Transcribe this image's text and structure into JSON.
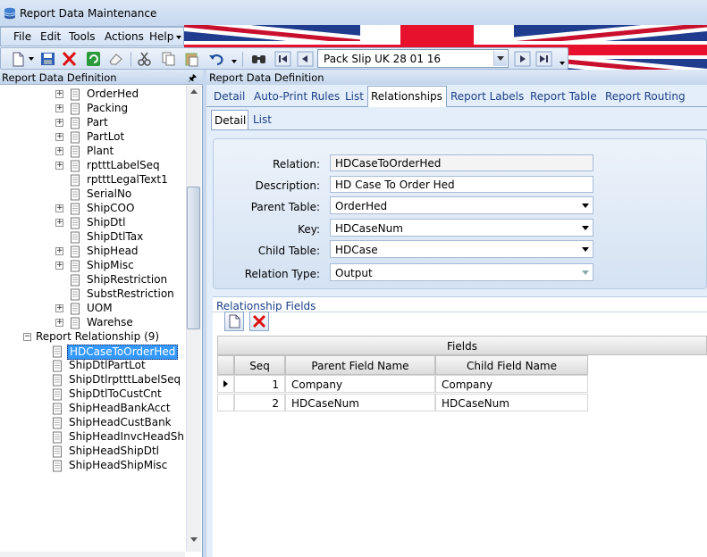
{
  "window": {
    "title": "Report Data Maintenance"
  },
  "menu": [
    "File",
    "Edit",
    "Tools",
    "Actions",
    "Help"
  ],
  "toolbar": {
    "record_selector": "Pack Slip UK 28 01 16"
  },
  "left_panel": {
    "title": "Report Data Definition",
    "tree_items": [
      {
        "label": "OrderHed",
        "expandable": true
      },
      {
        "label": "Packing",
        "expandable": true
      },
      {
        "label": "Part",
        "expandable": true
      },
      {
        "label": "PartLot",
        "expandable": true
      },
      {
        "label": "Plant",
        "expandable": true
      },
      {
        "label": "rptttLabelSeq",
        "expandable": true
      },
      {
        "label": "rptttLegalText1",
        "expandable": false
      },
      {
        "label": "SerialNo",
        "expandable": false
      },
      {
        "label": "ShipCOO",
        "expandable": true
      },
      {
        "label": "ShipDtl",
        "expandable": true
      },
      {
        "label": "ShipDtlTax",
        "expandable": false
      },
      {
        "label": "ShipHead",
        "expandable": true
      },
      {
        "label": "ShipMisc",
        "expandable": true
      },
      {
        "label": "ShipRestriction",
        "expandable": false
      },
      {
        "label": "SubstRestriction",
        "expandable": false
      },
      {
        "label": "UOM",
        "expandable": true
      },
      {
        "label": "Warehse",
        "expandable": true
      }
    ],
    "relationship_node": "Report Relationship (9)",
    "relationships": [
      "HDCaseToOrderHed",
      "ShipDtlPartLot",
      "ShipDtlrptttLabelSeq",
      "ShipDtlToCustCnt",
      "ShipHeadBankAcct",
      "ShipHeadCustBank",
      "ShipHeadInvcHeadShi",
      "ShipHeadShipDtl",
      "ShipHeadShipMisc"
    ],
    "selected_relationship": "HDCaseToOrderHed"
  },
  "right_panel": {
    "title": "Report Data Definition",
    "tabs": [
      "Detail",
      "Auto-Print Rules",
      "List",
      "Relationships",
      "Report Labels",
      "Report Table",
      "Report Routing"
    ],
    "active_tab": "Relationships",
    "subtabs": [
      "Detail",
      "List"
    ],
    "active_subtab": "Detail",
    "form": {
      "relation_label": "Relation:",
      "relation_value": "HDCaseToOrderHed",
      "description_label": "Description:",
      "description_value": "HD Case To Order Hed",
      "parent_table_label": "Parent Table:",
      "parent_table_value": "OrderHed",
      "key_label": "Key:",
      "key_value": "HDCaseNum",
      "child_table_label": "Child Table:",
      "child_table_value": "HDCase",
      "relation_type_label": "Relation Type:",
      "relation_type_value": "Output"
    },
    "relationship_fields": {
      "title": "Relationship Fields",
      "band_header": "Fields",
      "columns": [
        "Seq",
        "Parent Field Name",
        "Child Field Name"
      ],
      "rows": [
        {
          "seq": "1",
          "parent": "Company",
          "child": "Company"
        },
        {
          "seq": "2",
          "parent": "HDCaseNum",
          "child": "HDCaseNum"
        }
      ]
    }
  }
}
